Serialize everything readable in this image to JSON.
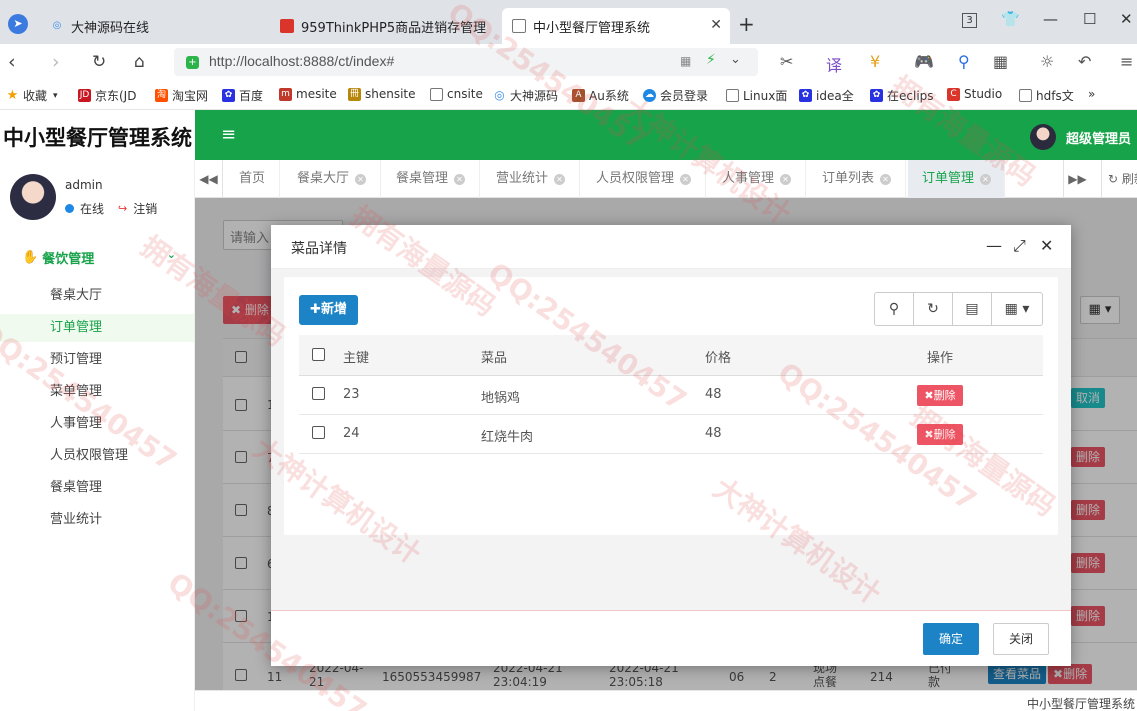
{
  "browser": {
    "tabs": [
      {
        "title": "大神源码在线",
        "active": false
      },
      {
        "title": "959ThinkPHP5商品进销存管理",
        "active": false
      },
      {
        "title": "中小型餐厅管理系统",
        "active": true
      }
    ],
    "url": "http://localhost:8888/ct/index#",
    "tab_counter": "3",
    "bookmarks": [
      "收藏",
      "京东(JD",
      "淘宝网",
      "百度",
      "mesite",
      "shensite",
      "cnsite",
      "大神源码",
      "Au系统",
      "会员登录",
      "Linux面",
      "idea全",
      "在eclips",
      "Studio",
      "hdfs文",
      "»"
    ]
  },
  "app": {
    "logo": "中小型餐厅管理系统",
    "admin_label": "超级管理员",
    "menu_toggle": "≡"
  },
  "sidebar": {
    "user_name": "admin",
    "status": "在线",
    "logout": "注销",
    "group": "餐饮管理",
    "items": [
      {
        "label": "餐桌大厅",
        "active": false
      },
      {
        "label": "订单管理",
        "active": true
      },
      {
        "label": "预订管理",
        "active": false
      },
      {
        "label": "菜单管理",
        "active": false
      },
      {
        "label": "人事管理",
        "active": false
      },
      {
        "label": "人员权限管理",
        "active": false
      },
      {
        "label": "餐桌管理",
        "active": false
      },
      {
        "label": "营业统计",
        "active": false
      }
    ]
  },
  "content_tabs": {
    "items": [
      {
        "label": "首页",
        "closable": false,
        "active": false
      },
      {
        "label": "餐桌大厅",
        "closable": true,
        "active": false
      },
      {
        "label": "餐桌管理",
        "closable": true,
        "active": false
      },
      {
        "label": "营业统计",
        "closable": true,
        "active": false
      },
      {
        "label": "人员权限管理",
        "closable": true,
        "active": false
      },
      {
        "label": "人事管理",
        "closable": true,
        "active": false
      },
      {
        "label": "订单列表",
        "closable": true,
        "active": false
      },
      {
        "label": "订单管理",
        "closable": true,
        "active": true
      }
    ],
    "refresh": "刷新"
  },
  "background": {
    "search_placeholder": "请输入",
    "delete_label": "删除",
    "partial_col_1": "1",
    "partial_col_2": "7",
    "partial_col_3": "8",
    "partial_col_4": "6",
    "partial_col_5": "1",
    "row_buttons": [
      "取消",
      "删除",
      "删除",
      "删除",
      "删除"
    ],
    "last_row": {
      "id": "11",
      "date": "2022-04-21",
      "order_no": "1650553459987",
      "start": "2022-04-21 23:04:19",
      "end": "2022-04-21 23:05:18",
      "table": "06",
      "people": "2",
      "type": "现场点餐",
      "amount": "214",
      "status": "已付款",
      "view_btn": "查看菜品",
      "delete_btn": "删除"
    }
  },
  "modal": {
    "title": "菜品详情",
    "add_label": "新增",
    "columns": {
      "id": "主键",
      "dish": "菜品",
      "price": "价格",
      "action": "操作"
    },
    "rows": [
      {
        "id": "23",
        "dish": "地锅鸡",
        "price": "48",
        "action": "删除"
      },
      {
        "id": "24",
        "dish": "红烧牛肉",
        "price": "48",
        "action": "删除"
      }
    ],
    "ok_label": "确定",
    "close_label": "关闭"
  },
  "footer": {
    "text": "中小型餐厅管理系统"
  },
  "watermarks": [
    "QQ:254540457",
    "大神计算机设计",
    "拥有海量源码",
    "QQ:254540457",
    "大神计算机设计",
    "拥有海量源码",
    "QQ:254540457",
    "大神计算机设计",
    "拥有海量源码",
    "QQ:254540457",
    "拥有海量源码",
    "QQ:254540457"
  ],
  "colors": {
    "brand_green": "#17a34a",
    "primary_blue": "#1c84c6",
    "danger_red": "#ed5565"
  }
}
